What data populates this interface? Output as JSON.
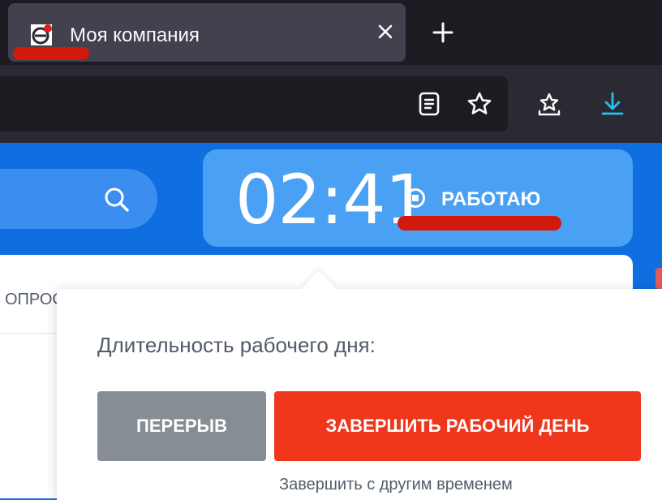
{
  "browser": {
    "tab": {
      "title": "Моя компания",
      "close_icon": "close-icon",
      "favicon": "bitrix24-favicon"
    },
    "new_tab_icon": "plus-icon",
    "toolbar": {
      "icons": [
        "reader-view-icon",
        "bookmark-star-icon",
        "bookmarks-icon",
        "download-icon"
      ]
    },
    "colors": {
      "tab_bg": "#42414d",
      "strip_bg": "#1c1b22",
      "toolbar_bg": "#2b2a33",
      "download_accent": "#27c0f0"
    }
  },
  "page": {
    "search_icon": "search-icon",
    "clock": {
      "time": "02:41",
      "status": "РАБОТАЮ",
      "status_icon": "stop-circle-icon"
    },
    "nav_partial_text": "ОПРОС",
    "colors": {
      "header_bg": "#0f6fe0",
      "clock_bg": "#4aa0f3"
    }
  },
  "popup": {
    "label": "Длительность рабочего дня:",
    "break_button": "ПЕРЕРЫВ",
    "finish_button": "ЗАВЕРШИТЬ РАБОЧИЙ ДЕНЬ",
    "sub_text": "Завершить с другим временем",
    "colors": {
      "break_bg": "#868d95",
      "finish_bg": "#f0371b"
    }
  },
  "annotations": {
    "highlight_color": "#d11a0c"
  }
}
